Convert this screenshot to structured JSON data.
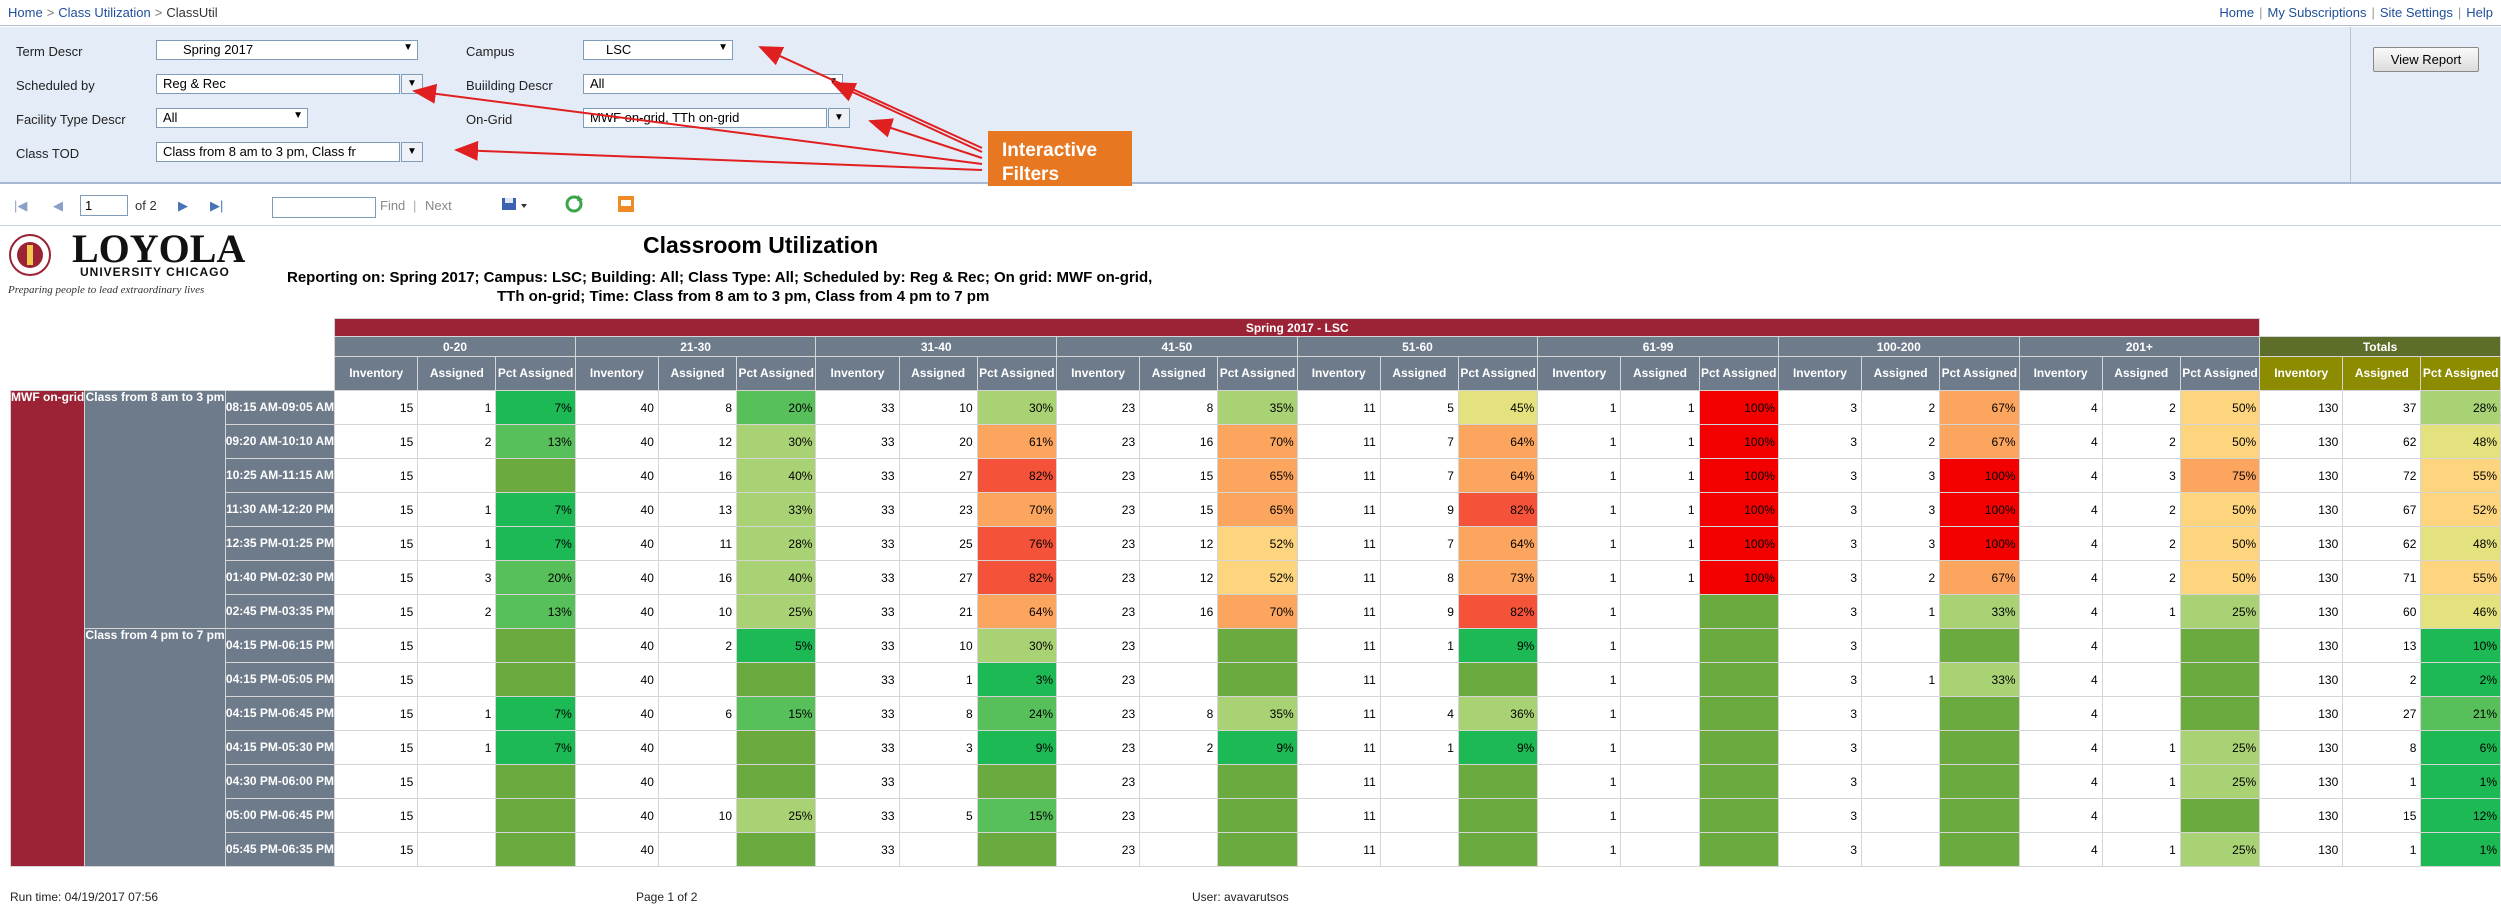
{
  "breadcrumb": [
    "Home",
    "Class Utilization",
    "ClassUtil"
  ],
  "top_links": [
    "Home",
    "My Subscriptions",
    "Site Settings",
    "Help"
  ],
  "params": {
    "term_label": "Term Descr",
    "term_value": "Spring 2017",
    "campus_label": "Campus",
    "campus_value": "LSC",
    "scheduled_label": "Scheduled by",
    "scheduled_value": "Reg & Rec",
    "building_label": "Buiilding Descr",
    "building_value": "All",
    "facility_label": "Facility Type Descr",
    "facility_value": "All",
    "ongrid_label": "On-Grid",
    "ongrid_value": "MWF on-grid, TTh on-grid",
    "tod_label": "Class TOD",
    "tod_value": "Class from 8 am to 3 pm, Class fr"
  },
  "view_report_label": "View Report",
  "annotation": "Interactive Filters",
  "toolbar": {
    "page": "1",
    "of": "of 2",
    "find": "Find",
    "next": "Next"
  },
  "report": {
    "logo_name": "LOYOLA",
    "logo_sub": "UNIVERSITY CHICAGO",
    "logo_tagline": "Preparing people to lead extraordinary lives",
    "title": "Classroom Utilization",
    "subtitle_line1": "Reporting on: Spring 2017; Campus: LSC; Building: All; Class Type: All; Scheduled by: Reg & Rec; On grid: MWF on-grid,",
    "subtitle_line2": "TTh on-grid; Time: Class from 8 am to 3 pm,   Class from 4 pm to 7 pm"
  },
  "table": {
    "term_header": "Spring 2017 - LSC",
    "groups": [
      "0-20",
      "21-30",
      "31-40",
      "41-50",
      "51-60",
      "61-99",
      "100-200",
      "201+"
    ],
    "totals_label": "Totals",
    "sub_headers": [
      "Inventory",
      "Assigned",
      "Pct Assigned"
    ],
    "row_label": "MWF on-grid",
    "tod_blocks": [
      {
        "label": "Class from 8 am to 3 pm",
        "rows": [
          {
            "time": "08:15 AM-09:05 AM",
            "cells": [
              [
                15,
                1,
                "7%"
              ],
              [
                40,
                8,
                "20%"
              ],
              [
                33,
                10,
                "30%"
              ],
              [
                23,
                8,
                "35%"
              ],
              [
                11,
                5,
                "45%"
              ],
              [
                1,
                1,
                "100%"
              ],
              [
                3,
                2,
                "67%"
              ],
              [
                4,
                2,
                "50%"
              ]
            ],
            "totals": [
              130,
              37,
              "28%"
            ]
          },
          {
            "time": "09:20 AM-10:10 AM",
            "cells": [
              [
                15,
                2,
                "13%"
              ],
              [
                40,
                12,
                "30%"
              ],
              [
                33,
                20,
                "61%"
              ],
              [
                23,
                16,
                "70%"
              ],
              [
                11,
                7,
                "64%"
              ],
              [
                1,
                1,
                "100%"
              ],
              [
                3,
                2,
                "67%"
              ],
              [
                4,
                2,
                "50%"
              ]
            ],
            "totals": [
              130,
              62,
              "48%"
            ]
          },
          {
            "time": "10:25 AM-11:15 AM",
            "cells": [
              [
                15,
                "",
                ""
              ],
              [
                40,
                16,
                "40%"
              ],
              [
                33,
                27,
                "82%"
              ],
              [
                23,
                15,
                "65%"
              ],
              [
                11,
                7,
                "64%"
              ],
              [
                1,
                1,
                "100%"
              ],
              [
                3,
                3,
                "100%"
              ],
              [
                4,
                3,
                "75%"
              ]
            ],
            "totals": [
              130,
              72,
              "55%"
            ]
          },
          {
            "time": "11:30 AM-12:20 PM",
            "cells": [
              [
                15,
                1,
                "7%"
              ],
              [
                40,
                13,
                "33%"
              ],
              [
                33,
                23,
                "70%"
              ],
              [
                23,
                15,
                "65%"
              ],
              [
                11,
                9,
                "82%"
              ],
              [
                1,
                1,
                "100%"
              ],
              [
                3,
                3,
                "100%"
              ],
              [
                4,
                2,
                "50%"
              ]
            ],
            "totals": [
              130,
              67,
              "52%"
            ]
          },
          {
            "time": "12:35 PM-01:25 PM",
            "cells": [
              [
                15,
                1,
                "7%"
              ],
              [
                40,
                11,
                "28%"
              ],
              [
                33,
                25,
                "76%"
              ],
              [
                23,
                12,
                "52%"
              ],
              [
                11,
                7,
                "64%"
              ],
              [
                1,
                1,
                "100%"
              ],
              [
                3,
                3,
                "100%"
              ],
              [
                4,
                2,
                "50%"
              ]
            ],
            "totals": [
              130,
              62,
              "48%"
            ]
          },
          {
            "time": "01:40 PM-02:30 PM",
            "cells": [
              [
                15,
                3,
                "20%"
              ],
              [
                40,
                16,
                "40%"
              ],
              [
                33,
                27,
                "82%"
              ],
              [
                23,
                12,
                "52%"
              ],
              [
                11,
                8,
                "73%"
              ],
              [
                1,
                1,
                "100%"
              ],
              [
                3,
                2,
                "67%"
              ],
              [
                4,
                2,
                "50%"
              ]
            ],
            "totals": [
              130,
              71,
              "55%"
            ]
          },
          {
            "time": "02:45 PM-03:35 PM",
            "cells": [
              [
                15,
                2,
                "13%"
              ],
              [
                40,
                10,
                "25%"
              ],
              [
                33,
                21,
                "64%"
              ],
              [
                23,
                16,
                "70%"
              ],
              [
                11,
                9,
                "82%"
              ],
              [
                1,
                "",
                ""
              ],
              [
                3,
                1,
                "33%"
              ],
              [
                4,
                1,
                "25%"
              ]
            ],
            "totals": [
              130,
              60,
              "46%"
            ]
          }
        ]
      },
      {
        "label": "Class from 4 pm to 7 pm",
        "rows": [
          {
            "time": "04:15 PM-06:15 PM",
            "cells": [
              [
                15,
                "",
                ""
              ],
              [
                40,
                2,
                "5%"
              ],
              [
                33,
                10,
                "30%"
              ],
              [
                23,
                "",
                ""
              ],
              [
                11,
                1,
                "9%"
              ],
              [
                1,
                "",
                ""
              ],
              [
                3,
                "",
                ""
              ],
              [
                4,
                "",
                ""
              ]
            ],
            "totals": [
              130,
              13,
              "10%"
            ]
          },
          {
            "time": "04:15 PM-05:05 PM",
            "cells": [
              [
                15,
                "",
                ""
              ],
              [
                40,
                "",
                ""
              ],
              [
                33,
                1,
                "3%"
              ],
              [
                23,
                "",
                ""
              ],
              [
                11,
                "",
                ""
              ],
              [
                1,
                "",
                ""
              ],
              [
                3,
                1,
                "33%"
              ],
              [
                4,
                "",
                ""
              ]
            ],
            "totals": [
              130,
              2,
              "2%"
            ]
          },
          {
            "time": "04:15 PM-06:45 PM",
            "cells": [
              [
                15,
                1,
                "7%"
              ],
              [
                40,
                6,
                "15%"
              ],
              [
                33,
                8,
                "24%"
              ],
              [
                23,
                8,
                "35%"
              ],
              [
                11,
                4,
                "36%"
              ],
              [
                1,
                "",
                ""
              ],
              [
                3,
                "",
                ""
              ],
              [
                4,
                "",
                ""
              ]
            ],
            "totals": [
              130,
              27,
              "21%"
            ]
          },
          {
            "time": "04:15 PM-05:30 PM",
            "cells": [
              [
                15,
                1,
                "7%"
              ],
              [
                40,
                "",
                ""
              ],
              [
                33,
                3,
                "9%"
              ],
              [
                23,
                2,
                "9%"
              ],
              [
                11,
                1,
                "9%"
              ],
              [
                1,
                "",
                ""
              ],
              [
                3,
                "",
                ""
              ],
              [
                4,
                1,
                "25%"
              ]
            ],
            "totals": [
              130,
              8,
              "6%"
            ]
          },
          {
            "time": "04:30 PM-06:00 PM",
            "cells": [
              [
                15,
                "",
                ""
              ],
              [
                40,
                "",
                ""
              ],
              [
                33,
                "",
                ""
              ],
              [
                23,
                "",
                ""
              ],
              [
                11,
                "",
                ""
              ],
              [
                1,
                "",
                ""
              ],
              [
                3,
                "",
                ""
              ],
              [
                4,
                1,
                "25%"
              ]
            ],
            "totals": [
              130,
              1,
              "1%"
            ]
          },
          {
            "time": "05:00 PM-06:45 PM",
            "cells": [
              [
                15,
                "",
                ""
              ],
              [
                40,
                10,
                "25%"
              ],
              [
                33,
                5,
                "15%"
              ],
              [
                23,
                "",
                ""
              ],
              [
                11,
                "",
                ""
              ],
              [
                1,
                "",
                ""
              ],
              [
                3,
                "",
                ""
              ],
              [
                4,
                "",
                ""
              ]
            ],
            "totals": [
              130,
              15,
              "12%"
            ]
          },
          {
            "time": "05:45 PM-06:35 PM",
            "cells": [
              [
                15,
                "",
                ""
              ],
              [
                40,
                "",
                ""
              ],
              [
                33,
                "",
                ""
              ],
              [
                23,
                "",
                ""
              ],
              [
                11,
                "",
                ""
              ],
              [
                1,
                "",
                ""
              ],
              [
                3,
                "",
                ""
              ],
              [
                4,
                1,
                "25%"
              ]
            ],
            "totals": [
              130,
              1,
              "1%"
            ]
          }
        ]
      }
    ]
  },
  "footer": {
    "run_time": "Run time: 04/19/2017 07:56",
    "page": "Page 1 of 2",
    "user": "User: avavarutsos"
  },
  "colors": {
    "maroon": "#9b2335",
    "slate": "#6e7b8b",
    "totals_olive": "#8d8c00",
    "empty_pct": "#6aaa3e",
    "annotation_orange": "#e87722"
  }
}
